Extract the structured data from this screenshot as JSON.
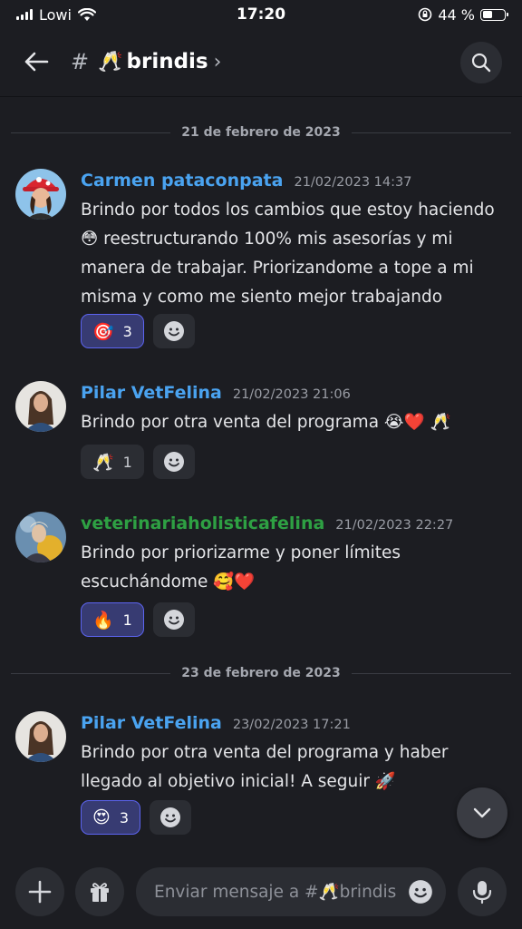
{
  "status_bar": {
    "carrier": "Lowi",
    "time": "17:20",
    "battery": "44 %",
    "battery_level": 0.44
  },
  "header": {
    "channel_hash": "#",
    "channel_emoji": "🥂",
    "channel_name": "brindis",
    "chevron": "›",
    "back_icon": "arrow-left-icon",
    "search_icon": "search-icon"
  },
  "date_separators": [
    "21 de febrero de 2023",
    "23 de febrero de 2023"
  ],
  "messages": [
    {
      "author": "Carmen pataconpata",
      "author_color": "#4aa3f0",
      "timestamp": "21/02/2023 14:37",
      "text": "Brindo por todos los cambios que estoy haciendo\n😳 reestructurando 100% mis asesorías y mi\nmanera de trabajar. Priorizandome a tope a mi\nmisma y como me siento mejor trabajando",
      "reactions": [
        {
          "emoji": "🎯",
          "count": "3",
          "active": true
        }
      ]
    },
    {
      "author": "Pilar VetFelina",
      "author_color": "#4aa3f0",
      "timestamp": "21/02/2023 21:06",
      "text": "Brindo por otra venta del programa 😭❤️ 🥂",
      "reactions": [
        {
          "emoji": "🥂",
          "count": "1",
          "active": false
        }
      ]
    },
    {
      "author": "veterinariaholisticafelina",
      "author_color": "#2ea043",
      "timestamp": "21/02/2023 22:27",
      "text": "Brindo por priorizarme y poner límites\nescuchándome 🥰❤️",
      "reactions": [
        {
          "emoji": "🔥",
          "count": "1",
          "active": true
        }
      ]
    },
    {
      "author": "Pilar VetFelina",
      "author_color": "#4aa3f0",
      "timestamp": "23/02/2023 17:21",
      "text": "Brindo por otra venta del programa y haber\nllegado al objetivo inicial! A seguir 🚀",
      "reactions": [
        {
          "emoji": "😍",
          "count": "3",
          "active": true
        }
      ]
    }
  ],
  "composer": {
    "placeholder": "Enviar mensaje a #🥂brindis",
    "add_icon": "plus-icon",
    "gift_icon": "gift-icon",
    "emoji_icon": "emoji-smile-icon",
    "mic_icon": "microphone-icon"
  },
  "scroll_down_icon": "chevron-down-icon"
}
